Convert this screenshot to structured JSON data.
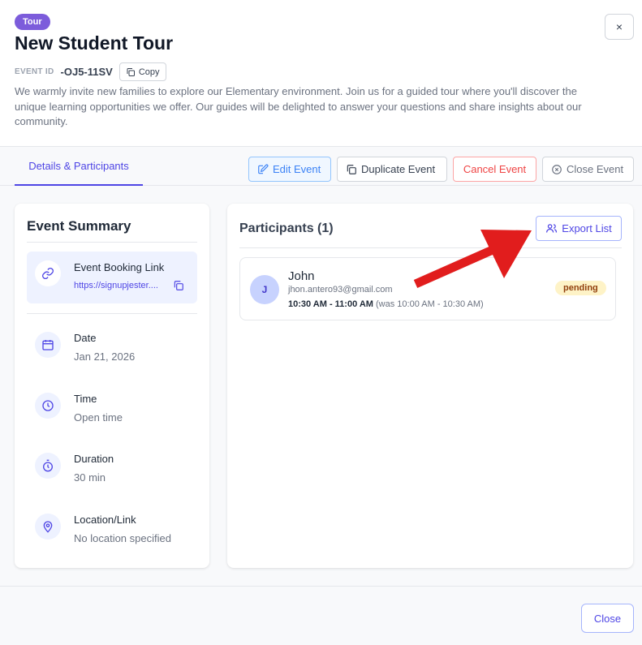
{
  "header": {
    "badge": "Tour",
    "title": "New Student Tour",
    "close_icon": "×",
    "event_id_label": "EVENT ID",
    "event_id_value": "-OJ5-11SV",
    "copy_label": "Copy",
    "description": "We warmly invite new families to explore our Elementary environment. Join us for a guided tour where you'll discover the unique learning opportunities we offer. Our guides will be delighted to answer your questions and share insights about our community."
  },
  "tabs": [
    {
      "label": "Details & Participants",
      "active": true
    }
  ],
  "actions": {
    "edit": "Edit Event",
    "duplicate": "Duplicate Event",
    "cancel": "Cancel Event",
    "close": "Close Event"
  },
  "summary": {
    "title": "Event Summary",
    "booking_label": "Event Booking Link",
    "booking_link": "https://signupjester....",
    "items": [
      {
        "label": "Date",
        "value": "Jan 21, 2026",
        "icon": "calendar-icon"
      },
      {
        "label": "Time",
        "value": "Open time",
        "icon": "clock-icon"
      },
      {
        "label": "Duration",
        "value": "30 min",
        "icon": "stopwatch-icon"
      },
      {
        "label": "Location/Link",
        "value": "No location specified",
        "icon": "map-pin-icon"
      }
    ]
  },
  "participants": {
    "title": "Participants (1)",
    "export_label": "Export List",
    "list": [
      {
        "initial": "J",
        "name": "John",
        "email": "jhon.antero93@gmail.com",
        "time": "10:30 AM - 11:00 AM",
        "was": "(was 10:00 AM - 10:30 AM)",
        "status": "pending"
      }
    ]
  },
  "footer": {
    "close_label": "Close"
  },
  "colors": {
    "accent": "#4f46e5",
    "badge": "#7c5cdb",
    "danger": "#ef4444",
    "arrow": "#e11d1d",
    "pending_bg": "#fef3c7"
  }
}
